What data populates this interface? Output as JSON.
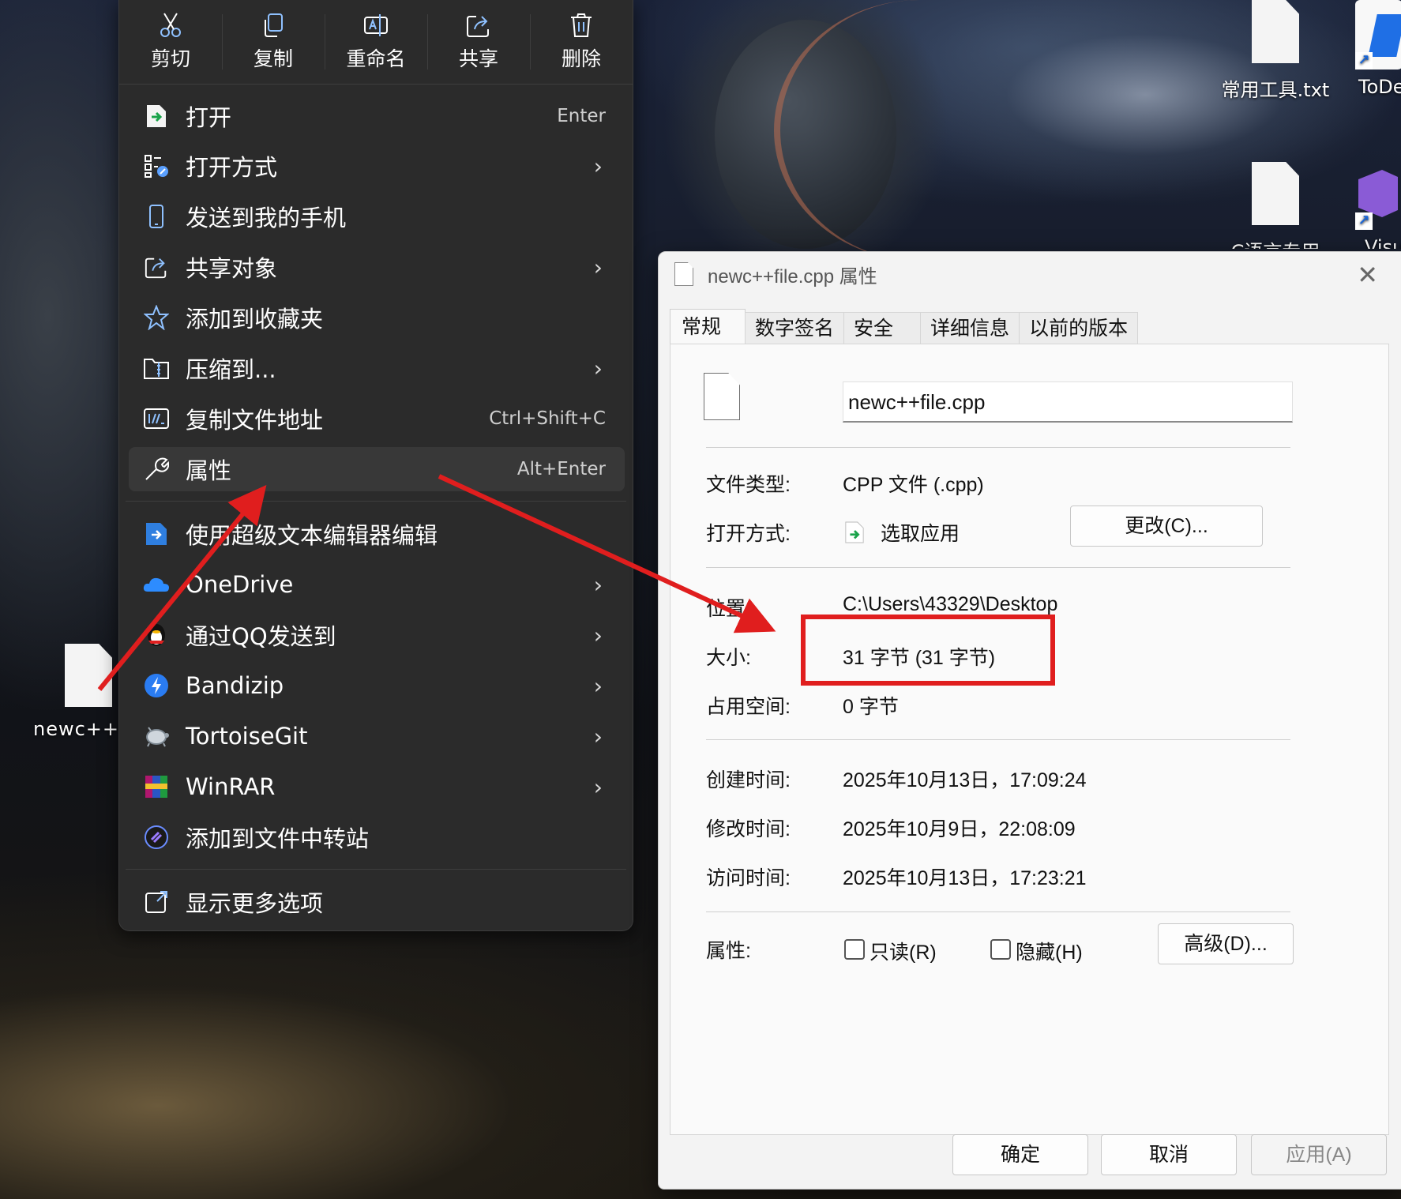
{
  "desktop": {
    "icons": [
      {
        "label": "常用工具.txt"
      },
      {
        "label": "ToDe"
      },
      {
        "label": "C语言专用"
      },
      {
        "label": "Visu"
      },
      {
        "label": "newc++f"
      }
    ]
  },
  "context_menu": {
    "toolbar": [
      {
        "label": "剪切",
        "icon": "cut-icon"
      },
      {
        "label": "复制",
        "icon": "copy-icon"
      },
      {
        "label": "重命名",
        "icon": "rename-icon"
      },
      {
        "label": "共享",
        "icon": "share-icon"
      },
      {
        "label": "删除",
        "icon": "delete-icon"
      }
    ],
    "items": [
      {
        "label": "打开",
        "shortcut": "Enter",
        "icon": "open-file-icon"
      },
      {
        "label": "打开方式",
        "icon": "open-with-icon",
        "submenu": true
      },
      {
        "label": "发送到我的手机",
        "icon": "phone-icon"
      },
      {
        "label": "共享对象",
        "icon": "share-icon",
        "submenu": true
      },
      {
        "label": "添加到收藏夹",
        "icon": "star-icon"
      },
      {
        "label": "压缩到...",
        "icon": "zip-folder-icon",
        "submenu": true
      },
      {
        "label": "复制文件地址",
        "shortcut": "Ctrl+Shift+C",
        "icon": "copy-path-icon"
      },
      {
        "label": "属性",
        "shortcut": "Alt+Enter",
        "icon": "wrench-icon",
        "highlighted": true
      },
      {
        "label": "使用超级文本编辑器编辑",
        "icon": "text-editor-icon"
      },
      {
        "label": "OneDrive",
        "icon": "onedrive-cloud-icon",
        "submenu": true
      },
      {
        "label": "通过QQ发送到",
        "icon": "qq-penguin-icon",
        "submenu": true
      },
      {
        "label": "Bandizip",
        "icon": "bandizip-icon",
        "submenu": true
      },
      {
        "label": "TortoiseGit",
        "icon": "tortoisegit-icon",
        "submenu": true
      },
      {
        "label": "WinRAR",
        "icon": "winrar-icon",
        "submenu": true
      },
      {
        "label": "添加到文件中转站",
        "icon": "transfer-station-icon"
      },
      {
        "label": "显示更多选项",
        "icon": "more-options-icon"
      }
    ],
    "chevron": "›"
  },
  "dialog": {
    "title": "newc++file.cpp 属性",
    "close_glyph": "✕",
    "tabs": [
      "常规",
      "数字签名",
      "安全",
      "详细信息",
      "以前的版本"
    ],
    "active_tab": "常规",
    "file_name": "newc++file.cpp",
    "rows": {
      "type": {
        "label": "文件类型:",
        "value": "CPP 文件 (.cpp)"
      },
      "open_with": {
        "label": "打开方式:",
        "value": "选取应用",
        "button": "更改(C)..."
      },
      "location": {
        "label": "位置:",
        "value": "C:\\Users\\43329\\Desktop"
      },
      "size": {
        "label": "大小:",
        "value": "31 字节 (31 字节)"
      },
      "size_on_disk": {
        "label": "占用空间:",
        "value": "0 字节"
      },
      "created": {
        "label": "创建时间:",
        "value": "2025年10月13日，17:09:24"
      },
      "modified": {
        "label": "修改时间:",
        "value": "2025年10月9日，22:08:09"
      },
      "accessed": {
        "label": "访问时间:",
        "value": "2025年10月13日，17:23:21"
      },
      "attributes": {
        "label": "属性:",
        "readonly": "只读(R)",
        "hidden": "隐藏(H)",
        "advanced": "高级(D)..."
      }
    },
    "footer": {
      "ok": "确定",
      "cancel": "取消",
      "apply": "应用(A)"
    }
  },
  "colors": {
    "menu_bg": "#2b2b2b",
    "menu_highlight": "#383838",
    "dialog_bg": "#f3f3f3",
    "annotation_red": "#e01e1e"
  }
}
